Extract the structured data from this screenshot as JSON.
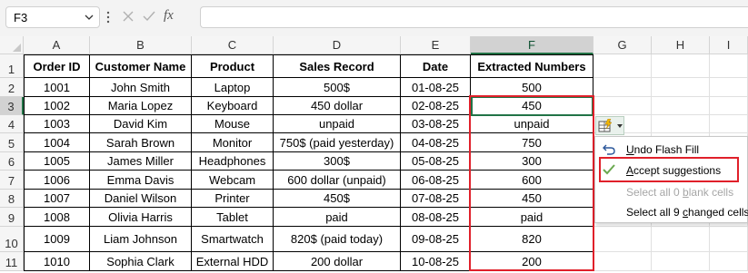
{
  "name_box": {
    "value": "F3"
  },
  "formula_bar": {
    "fx_label": "fx",
    "value": ""
  },
  "columns": [
    {
      "id": "A",
      "selected": false
    },
    {
      "id": "B",
      "selected": false
    },
    {
      "id": "C",
      "selected": false
    },
    {
      "id": "D",
      "selected": false
    },
    {
      "id": "E",
      "selected": false
    },
    {
      "id": "F",
      "selected": true
    },
    {
      "id": "G",
      "selected": false
    },
    {
      "id": "H",
      "selected": false
    },
    {
      "id": "I",
      "selected": false
    }
  ],
  "row_numbers": [
    "1",
    "2",
    "3",
    "4",
    "5",
    "6",
    "7",
    "8",
    "9",
    "10",
    "11"
  ],
  "selected_row": "3",
  "headers": [
    "Order ID",
    "Customer Name",
    "Product",
    "Sales Record",
    "Date",
    "Extracted Numbers"
  ],
  "rows": [
    [
      "1001",
      "John Smith",
      "Laptop",
      "500$",
      "01-08-25",
      "500"
    ],
    [
      "1002",
      "Maria Lopez",
      "Keyboard",
      "450 dollar",
      "02-08-25",
      "450"
    ],
    [
      "1003",
      "David Kim",
      "Mouse",
      "unpaid",
      "03-08-25",
      "unpaid"
    ],
    [
      "1004",
      "Sarah Brown",
      "Monitor",
      "750$ (paid yesterday)",
      "04-08-25",
      "750"
    ],
    [
      "1005",
      "James Miller",
      "Headphones",
      "300$",
      "05-08-25",
      "300"
    ],
    [
      "1006",
      "Emma Davis",
      "Webcam",
      "600 dollar (unpaid)",
      "06-08-25",
      "600"
    ],
    [
      "1007",
      "Daniel Wilson",
      "Printer",
      "450$",
      "07-08-25",
      "450"
    ],
    [
      "1008",
      "Olivia Harris",
      "Tablet",
      "paid",
      "08-08-25",
      "paid"
    ],
    [
      "1009",
      "Liam Johnson",
      "Smartwatch",
      "820$ (paid today)",
      "09-08-25",
      "820"
    ],
    [
      "1010",
      "Sophia Clark",
      "External HDD",
      "200 dollar",
      "10-08-25",
      "200"
    ]
  ],
  "flash_fill_menu": {
    "items": [
      {
        "label": "Undo Flash Fill",
        "underline_char": "U",
        "rest": "ndo Flash Fill",
        "enabled": true,
        "icon": "undo-icon"
      },
      {
        "label": "Accept suggestions",
        "underline_char": "A",
        "rest": "ccept suggestions",
        "enabled": true,
        "icon": "checkmark-icon"
      },
      {
        "label": "Select all 0 blank cells",
        "pre": "Select all 0 ",
        "underline_char": "b",
        "rest": "lank cells",
        "enabled": false
      },
      {
        "label": "Select all 9 changed cells",
        "pre": "Select all 9 ",
        "underline_char": "c",
        "rest": "hanged cells",
        "enabled": true
      }
    ]
  },
  "colors": {
    "accent_green": "#217346",
    "highlight_red": "#e0202a",
    "check_green": "#6aa84f",
    "undo_blue": "#2b579a"
  }
}
